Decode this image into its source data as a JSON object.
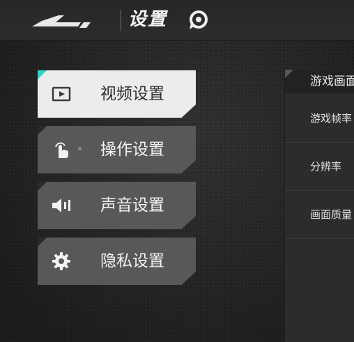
{
  "header": {
    "title": "设置",
    "back_icon": "back-arrow-icon",
    "help_icon": "help-icon"
  },
  "menu": {
    "items": [
      {
        "label": "视频设置",
        "icon": "video-icon",
        "active": true
      },
      {
        "label": "操作设置",
        "icon": "touch-hand-icon",
        "active": false
      },
      {
        "label": "声音设置",
        "icon": "speaker-icon",
        "active": false
      },
      {
        "label": "隐私设置",
        "icon": "gear-icon",
        "active": false
      }
    ]
  },
  "panel": {
    "title": "游戏画面",
    "rows": [
      {
        "label": "游戏帧率"
      },
      {
        "label": "分辨率"
      },
      {
        "label": "画面质量"
      }
    ]
  },
  "colors": {
    "accent": "#35d3cd",
    "active_bg": "#ececec",
    "item_bg": "#58585a",
    "background": "#2b2b2d"
  }
}
